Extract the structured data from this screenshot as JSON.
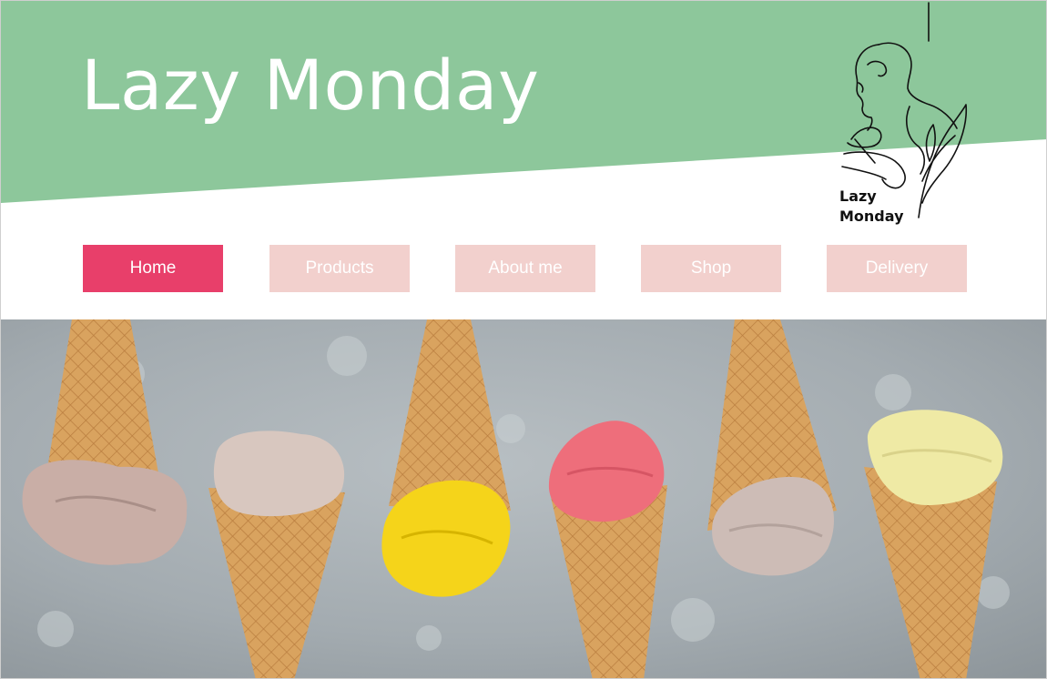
{
  "site": {
    "title": "Lazy Monday",
    "logo_line1": "Lazy",
    "logo_line2": "Monday"
  },
  "nav": {
    "items": [
      {
        "label": "Home",
        "active": true
      },
      {
        "label": "Products",
        "active": false
      },
      {
        "label": "About me",
        "active": false
      },
      {
        "label": "Shop",
        "active": false
      },
      {
        "label": "Delivery",
        "active": false
      }
    ]
  },
  "colors": {
    "header_green": "#8dc79b",
    "nav_active": "#e83f6a",
    "nav_inactive": "#f2d0cd",
    "hero_background": "#a9b1b5"
  },
  "hero": {
    "scoop_colors": [
      "#c9aea6",
      "#d8c7bf",
      "#f5d41a",
      "#ee6e7b",
      "#cdbcb6",
      "#efeaa5"
    ]
  }
}
